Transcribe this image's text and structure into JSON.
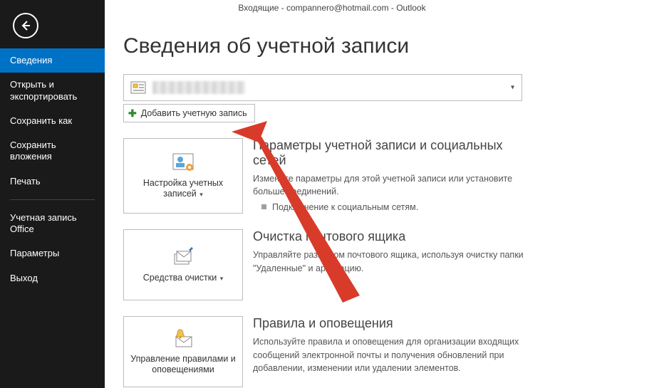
{
  "window_title": "Входящие - compannero@hotmail.com - Outlook",
  "sidebar": {
    "items": [
      {
        "label": "Сведения"
      },
      {
        "label": "Открыть и экспортировать"
      },
      {
        "label": "Сохранить как"
      },
      {
        "label": "Сохранить вложения"
      },
      {
        "label": "Печать"
      },
      {
        "label": "Учетная запись Office"
      },
      {
        "label": "Параметры"
      },
      {
        "label": "Выход"
      }
    ]
  },
  "page": {
    "title": "Сведения об учетной записи",
    "add_account_label": "Добавить учетную запись",
    "account_dropdown_caret": "▾"
  },
  "sections": {
    "accounts": {
      "tile_label": "Настройка учетных записей",
      "heading": "Параметры учетной записи и социальных сетей",
      "desc": "Измените параметры для этой учетной записи или установите больше соединений.",
      "bullet": "Подключение к социальным сетям."
    },
    "cleanup": {
      "tile_label": "Средства очистки",
      "heading": "Очистка почтового ящика",
      "desc": "Управляйте размером почтового ящика, используя очистку папки \"Удаленные\" и архивацию."
    },
    "rules": {
      "tile_label": "Управление правилами и оповещениями",
      "heading": "Правила и оповещения",
      "desc": "Используйте правила и оповещения для организации входящих сообщений электронной почты и получения обновлений при добавлении, изменении или удалении элементов."
    }
  }
}
